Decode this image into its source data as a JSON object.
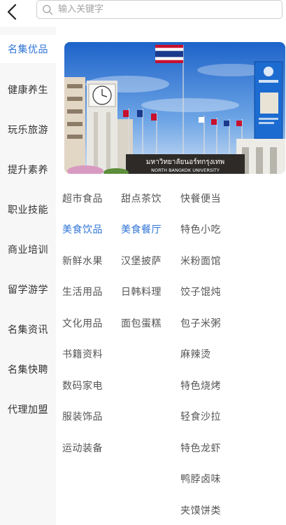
{
  "header": {
    "back_icon": "chevron-left-icon",
    "search_icon": "search-icon",
    "search_placeholder": "输入关键字",
    "search_value": ""
  },
  "sidebar": {
    "items": [
      {
        "label": "名集优品",
        "active": true
      },
      {
        "label": "健康养生",
        "active": false
      },
      {
        "label": "玩乐旅游",
        "active": false
      },
      {
        "label": "提升素养",
        "active": false
      },
      {
        "label": "职业技能",
        "active": false
      },
      {
        "label": "商业培训",
        "active": false
      },
      {
        "label": "留学游学",
        "active": false
      },
      {
        "label": "名集资讯",
        "active": false
      },
      {
        "label": "名集快聘",
        "active": false
      },
      {
        "label": "代理加盟",
        "active": false
      }
    ]
  },
  "banner": {
    "building_sign": "มหาวิทยาลัยนอร์ทกรุงเทพ",
    "building_sign_en": "NORTH BANGKOK UNIVERSITY"
  },
  "categories": {
    "col1": [
      {
        "label": "超市食品",
        "highlight": false
      },
      {
        "label": "美食饮品",
        "highlight": true
      },
      {
        "label": "新鲜水果",
        "highlight": false
      },
      {
        "label": "生活用品",
        "highlight": false
      },
      {
        "label": "文化用品",
        "highlight": false
      },
      {
        "label": "书籍资料",
        "highlight": false
      },
      {
        "label": "数码家电",
        "highlight": false
      },
      {
        "label": "服装饰品",
        "highlight": false
      },
      {
        "label": "运动装备",
        "highlight": false
      }
    ],
    "col2": [
      {
        "label": "甜点茶饮",
        "highlight": false
      },
      {
        "label": "美食餐厅",
        "highlight": true
      },
      {
        "label": "汉堡披萨",
        "highlight": false
      },
      {
        "label": "日韩料理",
        "highlight": false
      },
      {
        "label": "面包蛋糕",
        "highlight": false
      }
    ],
    "col3": [
      {
        "label": "快餐便当",
        "highlight": false
      },
      {
        "label": "特色小吃",
        "highlight": false
      },
      {
        "label": "米粉面馆",
        "highlight": false
      },
      {
        "label": "饺子馄炖",
        "highlight": false
      },
      {
        "label": "包子米粥",
        "highlight": false
      },
      {
        "label": "麻辣烫",
        "highlight": false
      },
      {
        "label": "特色烧烤",
        "highlight": false
      },
      {
        "label": "轻食沙拉",
        "highlight": false
      },
      {
        "label": "特色龙虾",
        "highlight": false
      },
      {
        "label": "鸭脖卤味",
        "highlight": false
      },
      {
        "label": "夹馍饼类",
        "highlight": false
      }
    ]
  },
  "colors": {
    "accent": "#2f74d6",
    "sidebar_bg": "#f7f7f7",
    "text": "#555555"
  }
}
